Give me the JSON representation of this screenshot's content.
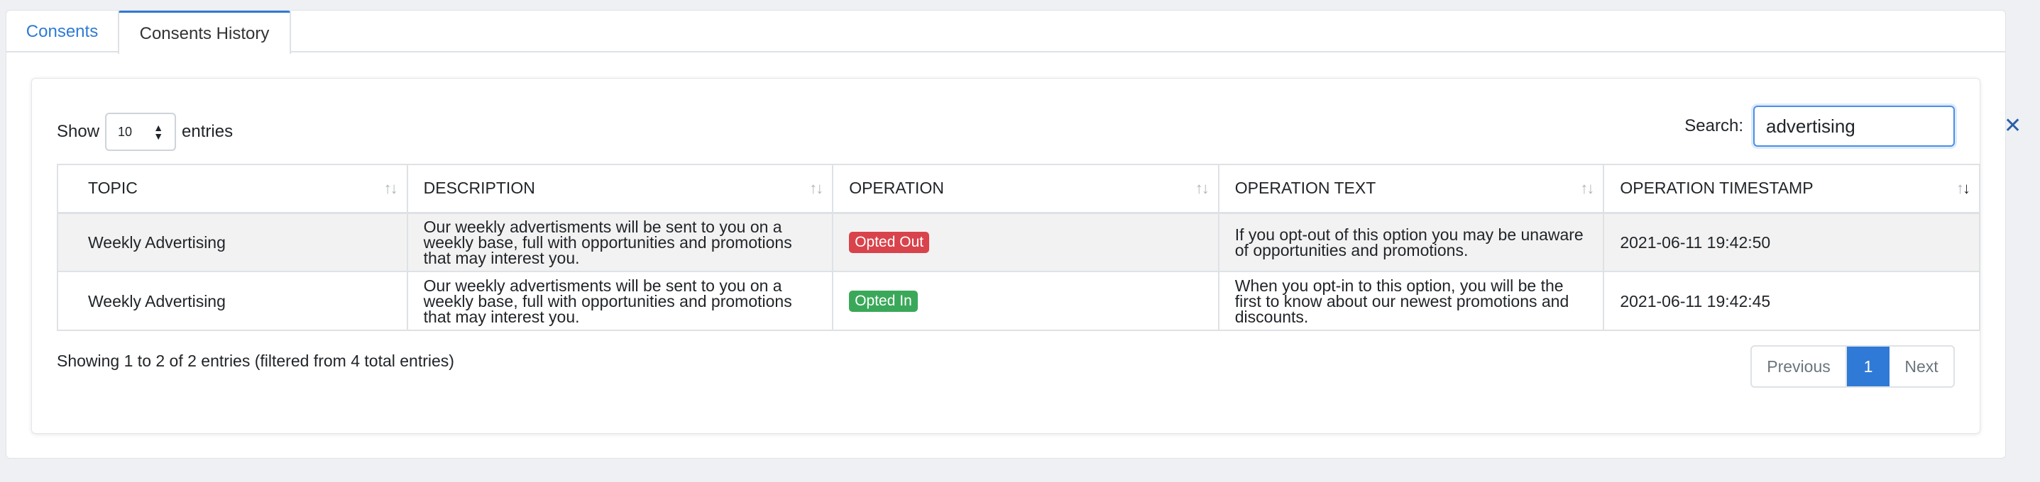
{
  "tabs": [
    {
      "label": "Consents"
    },
    {
      "label": "Consents History"
    }
  ],
  "length": {
    "show_label": "Show",
    "value": "10",
    "entries_label": "entries"
  },
  "search": {
    "label": "Search:",
    "value": "advertising"
  },
  "table": {
    "headers": [
      "TOPIC",
      "DESCRIPTION",
      "OPERATION",
      "OPERATION TEXT",
      "OPERATION TIMESTAMP"
    ],
    "rows": [
      {
        "topic": "Weekly Advertising",
        "description": "Our weekly advertisments will be sent to you on a weekly base, full with opportunities and promotions that may interest you.",
        "operation": "Opted Out",
        "operation_color": "#d9434b",
        "operation_text": "If you opt-out of this option you may be unaware of opportunities and promotions.",
        "timestamp": "2021-06-11 19:42:50"
      },
      {
        "topic": "Weekly Advertising",
        "description": "Our weekly advertisments will be sent to you on a weekly base, full with opportunities and promotions that may interest you.",
        "operation": "Opted In",
        "operation_color": "#3aa859",
        "operation_text": "When you opt-in to this option, you will be the first to know about our newest promotions and discounts.",
        "timestamp": "2021-06-11 19:42:45"
      }
    ]
  },
  "info": "Showing 1 to 2 of 2 entries (filtered from 4 total entries)",
  "pagination": {
    "previous": "Previous",
    "current": "1",
    "next": "Next"
  },
  "colors": {
    "accent": "#2f7ad6"
  }
}
